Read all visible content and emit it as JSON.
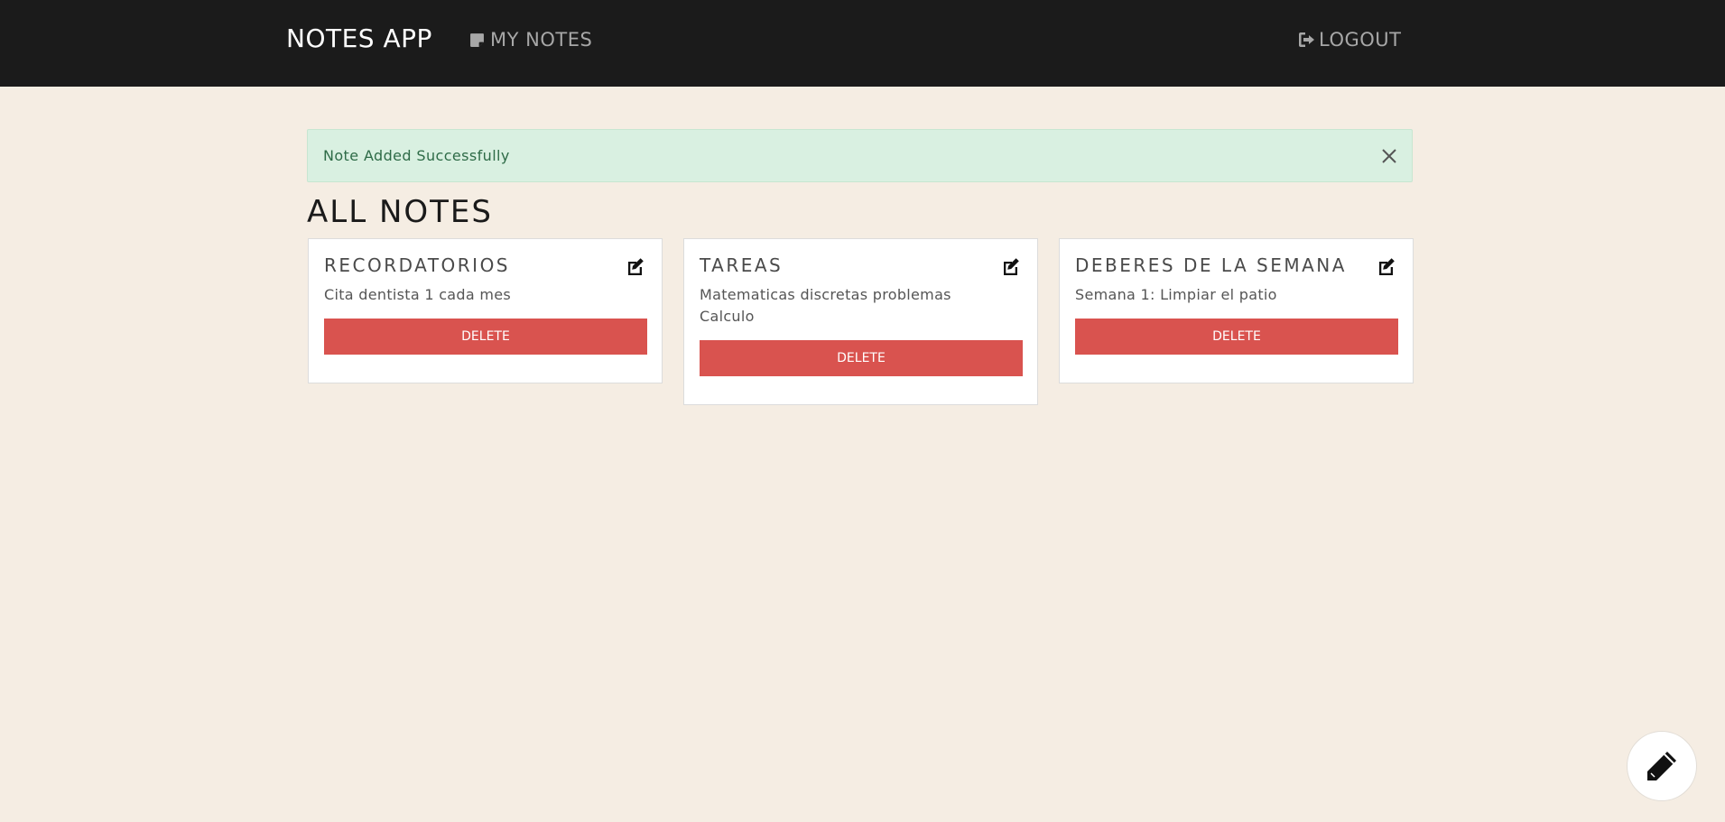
{
  "navbar": {
    "brand": "NOTES APP",
    "my_notes_label": "MY NOTES",
    "logout_label": "LOGOUT",
    "my_notes_icon": "sticky-note-icon",
    "logout_icon": "sign-out-icon"
  },
  "alert": {
    "message": "Note Added Successfully",
    "close_icon": "close-icon"
  },
  "page": {
    "title": "ALL NOTES"
  },
  "notes": [
    {
      "title": "RECORDATORIOS",
      "body": "Cita dentista 1 cada mes",
      "delete_label": "DELETE"
    },
    {
      "title": "TAREAS",
      "body": "Matematicas discretas problemas Calculo",
      "delete_label": "DELETE"
    },
    {
      "title": "DEBERES DE LA SEMANA",
      "body": "Semana 1: Limpiar el patio",
      "delete_label": "DELETE"
    }
  ],
  "fab": {
    "icon": "pencil-icon"
  },
  "colors": {
    "navbar_bg": "#1b1b1b",
    "page_bg": "#f5ede3",
    "alert_bg": "#d9f0e1",
    "alert_text": "#2e6b47",
    "delete_bg": "#d9534f"
  }
}
